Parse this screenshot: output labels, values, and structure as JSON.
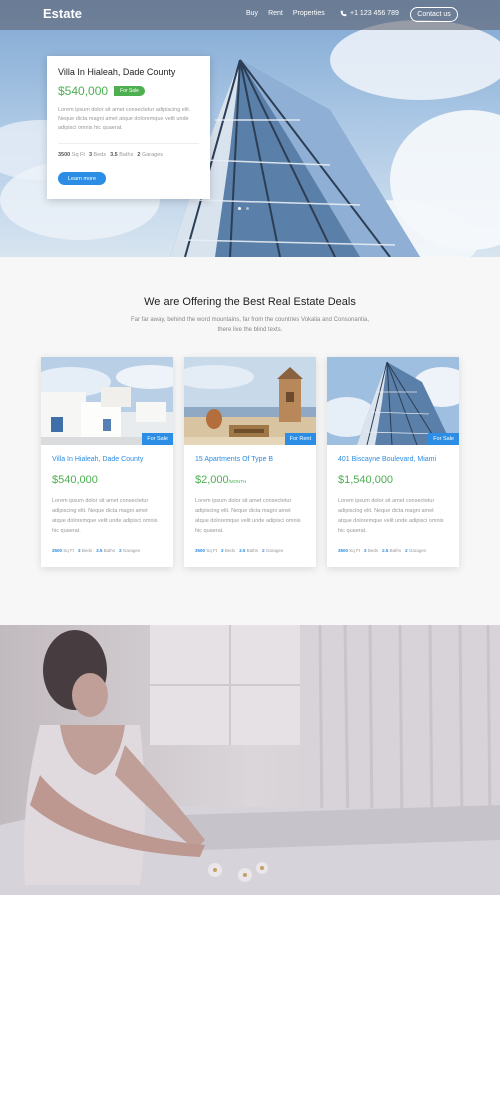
{
  "nav": {
    "brand": "Estate",
    "links": [
      "Buy",
      "Rent",
      "Properties"
    ],
    "phone": "+1 123 456 789",
    "contact_label": "Contact us"
  },
  "hero": {
    "title": "Villa In Hialeah, Dade County",
    "price": "$540,000",
    "badge": "For Sale",
    "description": "Lorem ipsum dolor sit amet consectetur adipiscing elit. Neque dicta magni amet atque doloremque velit unde adipisci omnis hic quaerat.",
    "features": [
      {
        "value": "3500",
        "label": "Sq Ft"
      },
      {
        "value": "3",
        "label": "Beds"
      },
      {
        "value": "3.5",
        "label": "Baths"
      },
      {
        "value": "2",
        "label": "Garages"
      }
    ],
    "button_label": "Learn more",
    "slide_count": 2,
    "active_slide": 1
  },
  "offer": {
    "heading": "We are Offering the Best Real Estate Deals",
    "subheading": "Far far away, behind the word mountains, far from the countries Vokalia and Consonantia, there live the blind texts."
  },
  "cards": [
    {
      "badge": "For Sale",
      "title": "Villa In Hialeah, Dade County",
      "price": "$540,000",
      "price_suffix": "",
      "description": "Lorem ipsum dolor sit amet consectetur adipiscing elit. Neque dicta magni amet atque doloremque velit unde adipisci omnis hic quaerat.",
      "features": [
        {
          "value": "3500",
          "label": "Sq Ft"
        },
        {
          "value": "3",
          "label": "Beds"
        },
        {
          "value": "3.5",
          "label": "Baths"
        },
        {
          "value": "2",
          "label": "Garages"
        }
      ]
    },
    {
      "badge": "For Rent",
      "title": "15 Apartments Of Type B",
      "price": "$2,000",
      "price_suffix": "/month",
      "description": "Lorem ipsum dolor sit amet consectetur adipiscing elit. Neque dicta magni amet atque doloremque velit unde adipisci omnis hic quaerat.",
      "features": [
        {
          "value": "3500",
          "label": "Sq Ft"
        },
        {
          "value": "3",
          "label": "Beds"
        },
        {
          "value": "3.5",
          "label": "Baths"
        },
        {
          "value": "2",
          "label": "Garages"
        }
      ]
    },
    {
      "badge": "For Sale",
      "title": "401 Biscayne Boulevard, Miami",
      "price": "$1,540,000",
      "price_suffix": "",
      "description": "Lorem ipsum dolor sit amet consectetur adipiscing elit. Neque dicta magni amet atque doloremque velit unde adipisci omnis hic quaerat.",
      "features": [
        {
          "value": "3500",
          "label": "Sq Ft"
        },
        {
          "value": "3",
          "label": "Beds"
        },
        {
          "value": "2.5",
          "label": "Baths"
        },
        {
          "value": "2",
          "label": "Garages"
        }
      ]
    }
  ],
  "icons": {
    "phone": "phone-icon"
  },
  "colors": {
    "accent_blue": "#2b8de3",
    "accent_green": "#4caf50"
  }
}
